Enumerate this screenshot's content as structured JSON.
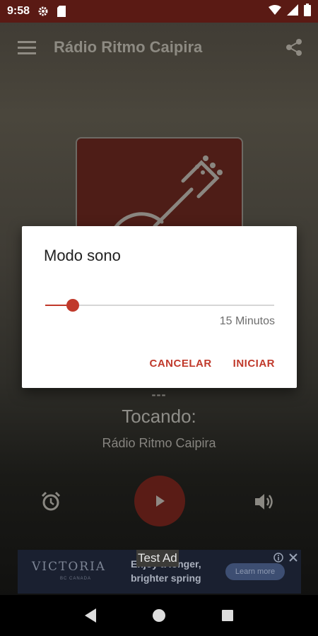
{
  "status_bar": {
    "time": "9:58",
    "icons": [
      "gear-icon",
      "sd-card-icon",
      "wifi-icon",
      "signal-icon",
      "battery-icon"
    ]
  },
  "app_bar": {
    "title": "Rádio Ritmo Caipira",
    "menu_icon": "hamburger-menu-icon",
    "share_icon": "share-icon"
  },
  "artwork": {
    "icon": "guitar-icon"
  },
  "player": {
    "track_placeholder": "---",
    "status_label": "Tocando:",
    "station_name": "Rádio Ritmo Caipira",
    "alarm_icon": "alarm-icon",
    "play_icon": "play-icon",
    "volume_icon": "volume-icon"
  },
  "dialog": {
    "title": "Modo sono",
    "slider_fraction": 0.12,
    "value_label": "15 Minutos",
    "cancel_label": "CANCELAR",
    "start_label": "INICIAR"
  },
  "ad": {
    "label": "Test Ad",
    "logo": "VICTORIA",
    "logo_sub": "BC CANADA",
    "copy_line1": "Enjoy a longer,",
    "copy_line2": "brighter spring",
    "cta": "Learn more"
  },
  "nav_bar": {
    "back_icon": "back-icon",
    "home_icon": "home-icon",
    "recents_icon": "recents-icon"
  },
  "colors": {
    "accent": "#c0392b",
    "status_bar": "#5a1a14",
    "artwork_bg": "#4e1d17"
  }
}
